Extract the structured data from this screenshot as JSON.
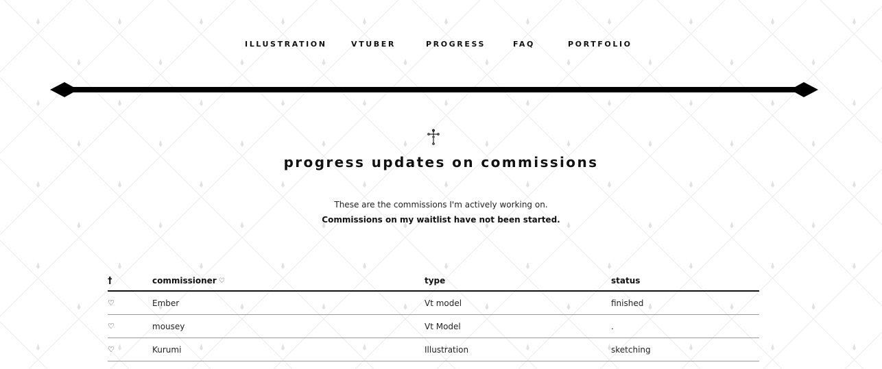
{
  "nav": {
    "items": [
      "ILLUSTRATION",
      "VTUBER",
      "PROGRESS",
      "FAQ",
      "PORTFOLIO"
    ]
  },
  "header": {
    "title": "progress updates on commissions",
    "intro_line1": "These are the commissions I'm actively working on.",
    "intro_line2": "Commissions on my waitlist have not been started."
  },
  "table": {
    "columns": {
      "marker": "†",
      "commissioner": "commissioner",
      "commissioner_icon": "heart-outline-icon",
      "type": "type",
      "status": "status"
    },
    "row_icon": "heart-outline-icon",
    "rows": [
      {
        "commissioner": "Ember",
        "type": "Vt model",
        "status": "finished"
      },
      {
        "commissioner": "mousey",
        "type": "Vt Model",
        "status": "."
      },
      {
        "commissioner": "Kurumi",
        "type": "Illustration",
        "status": "sketching"
      }
    ]
  },
  "colors": {
    "background": "#ffffff",
    "text": "#111111",
    "pattern": "#e8e8e8"
  }
}
